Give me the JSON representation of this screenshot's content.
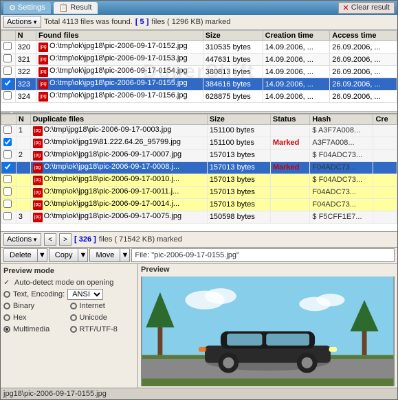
{
  "tabs": {
    "settings": "Settings",
    "result": "Result",
    "clear_btn": "Clear result"
  },
  "found_toolbar": {
    "actions_label": "Actions",
    "summary": "Total 4113 files was found.",
    "marked_count": "[ 5 ]",
    "marked_size": "files ( 1296 KB) marked"
  },
  "found_columns": [
    "N",
    "Found files",
    "Size",
    "Creation time",
    "Access time",
    ""
  ],
  "found_rows": [
    {
      "n": "320",
      "file": "O:\\tmp\\ok\\jpg18\\pic-2006-09-17-0152.jpg",
      "size": "310535 bytes",
      "created": "14.09.2006, ...",
      "access": "26.09.2006, ...",
      "highlight": false
    },
    {
      "n": "321",
      "file": "O:\\tmp\\ok\\jpg18\\pic-2006-09-17-0153.jpg",
      "size": "447631 bytes",
      "created": "14.09.2006, ...",
      "access": "26.09.2006, ...",
      "highlight": false
    },
    {
      "n": "322",
      "file": "O:\\tmp\\ok\\jpg18\\pic-2006-09-17-0154.jpg",
      "size": "380813 bytes",
      "created": "14.09.2006, ...",
      "access": "26.09.2006, ...",
      "highlight": false
    },
    {
      "n": "323",
      "file": "O:\\tmp\\ok\\jpg18\\pic-2006-09-17-0155.jpg",
      "size": "384616 bytes",
      "created": "14.09.2006, ...",
      "access": "26.09.2006, ...",
      "highlight": true
    },
    {
      "n": "324",
      "file": "O:\\tmp\\ok\\jpg18\\pic-2006-09-17-0156.jpg",
      "size": "628875 bytes",
      "created": "14.09.2006, ...",
      "access": "26.09.2006, ...",
      "highlight": false
    }
  ],
  "dup_columns": [
    "N",
    "Duplicate files",
    "Size",
    "Status",
    "Hash",
    "Cre"
  ],
  "dup_rows": [
    {
      "type": "group",
      "n": "1",
      "file": "O:\\tmp\\jpg18\\pic-2006-09-17-0003.jpg",
      "size": "151100 bytes",
      "status": "",
      "hash": "$ A3F7A008...",
      "highlight": false,
      "yellow": false
    },
    {
      "type": "dup",
      "n": "",
      "file": "O:\\tmp\\ok\\jpg19\\81.222.64.26_95799.jpg",
      "size": "151100 bytes",
      "status": "Marked",
      "hash": "A3F7A008...",
      "highlight": false,
      "yellow": false
    },
    {
      "type": "group",
      "n": "2",
      "file": "O:\\tmp\\ok\\jpg18\\pic-2006-09-17-0007.jpg",
      "size": "157013 bytes",
      "status": "",
      "hash": "$ F04ADC73...",
      "highlight": false,
      "yellow": false
    },
    {
      "type": "dup",
      "n": "",
      "file": "O:\\tmp\\ok\\jpg18\\pic-2006-09-17-0008.j...",
      "size": "157013 bytes",
      "status": "Marked",
      "hash": "F04ADC73...",
      "highlight": true,
      "yellow": false
    },
    {
      "type": "dup",
      "n": "",
      "file": "O:\\tmp\\ok\\jpg18\\pic-2006-09-17-0010.j...",
      "size": "157013 bytes",
      "status": "",
      "hash": "$ F04ADC73...",
      "highlight": false,
      "yellow": true
    },
    {
      "type": "dup",
      "n": "",
      "file": "O:\\tmp\\ok\\jpg18\\pic-2006-09-17-0011.j...",
      "size": "157013 bytes",
      "status": "",
      "hash": "F04ADC73...",
      "highlight": false,
      "yellow": true
    },
    {
      "type": "dup",
      "n": "",
      "file": "O:\\tmp\\ok\\jpg18\\pic-2006-09-17-0014.j...",
      "size": "157013 bytes",
      "status": "",
      "hash": "F04ADC73...",
      "highlight": false,
      "yellow": true
    },
    {
      "type": "group",
      "n": "3",
      "file": "O:\\tmp\\ok\\jpg18\\pic-2006-09-17-0075.jpg",
      "size": "150598 bytes",
      "status": "",
      "hash": "$ F5CFF1E7...",
      "highlight": false,
      "yellow": false
    }
  ],
  "bottom_toolbar": {
    "actions_label": "Actions",
    "prev": "<",
    "next": ">",
    "count_text": "[ 326 ]",
    "size_text": "files ( 71542 KB) marked"
  },
  "action_row": {
    "delete_label": "Delete",
    "copy_label": "Copy",
    "move_label": "Move",
    "file_label": "File: \"pic-2006-09-17-0155.jpg\""
  },
  "left_panel": {
    "title": "Preview mode",
    "auto_detect": "Auto-detect mode on opening",
    "text_encoding": "Text, Encoding:",
    "encoding_val": "ANSI",
    "binary": "Binary",
    "internet": "Internet",
    "hex": "Hex",
    "unicode": "Unicode",
    "multimedia": "Multimedia",
    "rtf_utf8": "RTF/UTF-8"
  },
  "right_panel": {
    "title": "Preview"
  },
  "status_bar": {
    "text": "jpg18\\pic-2006-09-17-0155.jpg"
  },
  "watermark": "DuperShift"
}
